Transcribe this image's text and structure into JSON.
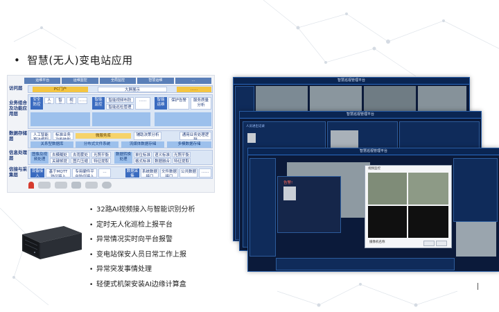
{
  "slide": {
    "title": "智慧(无人)变电站应用",
    "bullet": "•"
  },
  "diagram": {
    "top_tabs": [
      "运维平台",
      "运维监控",
      "全局监控",
      "智慧运维",
      "…"
    ],
    "rows": [
      {
        "label": "访问层",
        "blocks": [
          "PC门户",
          "大屏展示",
          "……"
        ]
      },
      {
        "label": "业务组合及功能应用层",
        "blocks": [
          "安全防控",
          "人员",
          "智能",
          "视频",
          "……",
          "智能监控",
          "智能视频布防",
          "智能巡检管理",
          "……",
          "智能运维",
          "保护告警",
          "服务质量分析"
        ]
      },
      {
        "label": "数据存储层",
        "blocks": [
          "人工智能算法模型库",
          "标准业务功能映射",
          "微服务库",
          "辅助决策分析",
          "通用业务处理逻辑",
          "关系型数据库",
          "分布式文件系统",
          "流媒体数据存储",
          "多模数据存储"
        ]
      },
      {
        "label": "信息处理层",
        "blocks": [
          "图像及视频处理",
          "去模糊处理",
          "关键帧提取",
          "去雨雾处理",
          "图片压缩",
          "光照平衡",
          "特征提取",
          "数据转换处理",
          "单位标准",
          "格式标准",
          "语义标准",
          "数据融合",
          "光照平衡",
          "特征提取"
        ]
      },
      {
        "label": "信接与采集层",
        "blocks": [
          "设备接入",
          "基于MQTT协议接入",
          "专用硬件平台协议接入",
          "…",
          "数据采集",
          "系统数据接口",
          "文件数据接口",
          "公共数据",
          "……"
        ]
      }
    ]
  },
  "features": [
    "32路AI视频接入与智能识别分析",
    "定时无人化巡检上报平台",
    "异常情况实时向平台报警",
    "变电站保安人员日常工作上报",
    "异常突发事情处理",
    "轻便式机架安装AI边缘计算盒"
  ],
  "screenshots": {
    "back_title": "智慧巡视管理平台",
    "middle_title": "智慧巡视管理平台",
    "front_title": "智慧巡视管理平台",
    "person_panel": "人员进出记录",
    "alert_title": "告警!",
    "dialog_title": "视频监控",
    "dialog_footer": "摄像机名称"
  },
  "colors": {
    "accent": "#3a6bc0",
    "dark_panel": "#0b1a3a"
  }
}
